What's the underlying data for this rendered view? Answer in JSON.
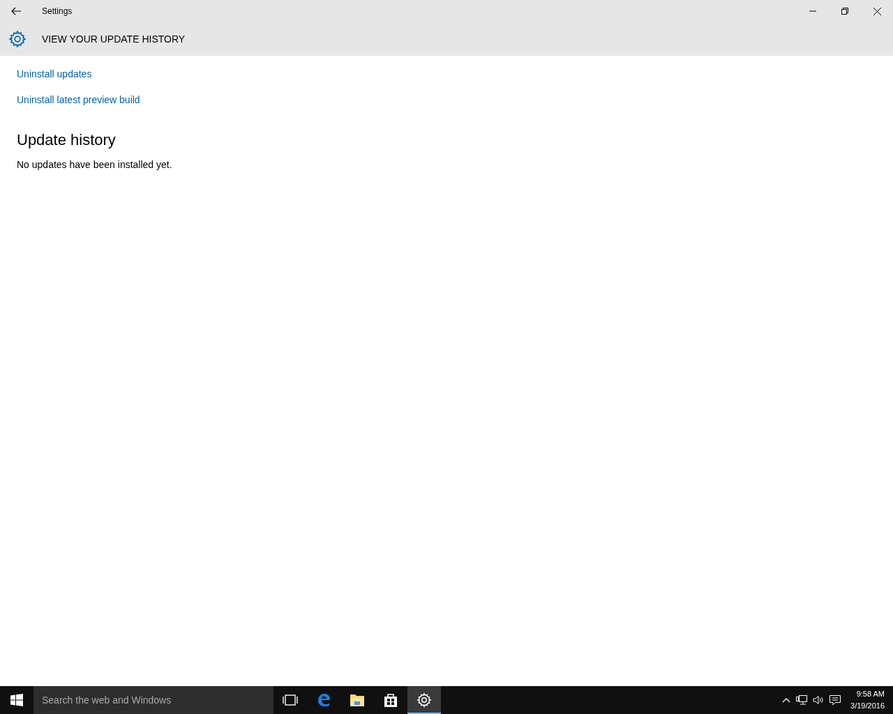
{
  "window": {
    "title": "Settings"
  },
  "header": {
    "title": "VIEW YOUR UPDATE HISTORY"
  },
  "links": [
    "Uninstall updates",
    "Uninstall latest preview build"
  ],
  "section": {
    "heading": "Update history",
    "message": "No updates have been installed yet."
  },
  "taskbar": {
    "search": {
      "placeholder": "Search the web and Windows"
    },
    "apps": [
      {
        "kind": "taskview",
        "selected": false
      },
      {
        "kind": "edge",
        "selected": false
      },
      {
        "kind": "explorer",
        "selected": false
      },
      {
        "kind": "store",
        "selected": false
      },
      {
        "kind": "settings",
        "selected": true
      }
    ],
    "clock": {
      "time": "9:58 AM",
      "date": "3/19/2016"
    }
  }
}
